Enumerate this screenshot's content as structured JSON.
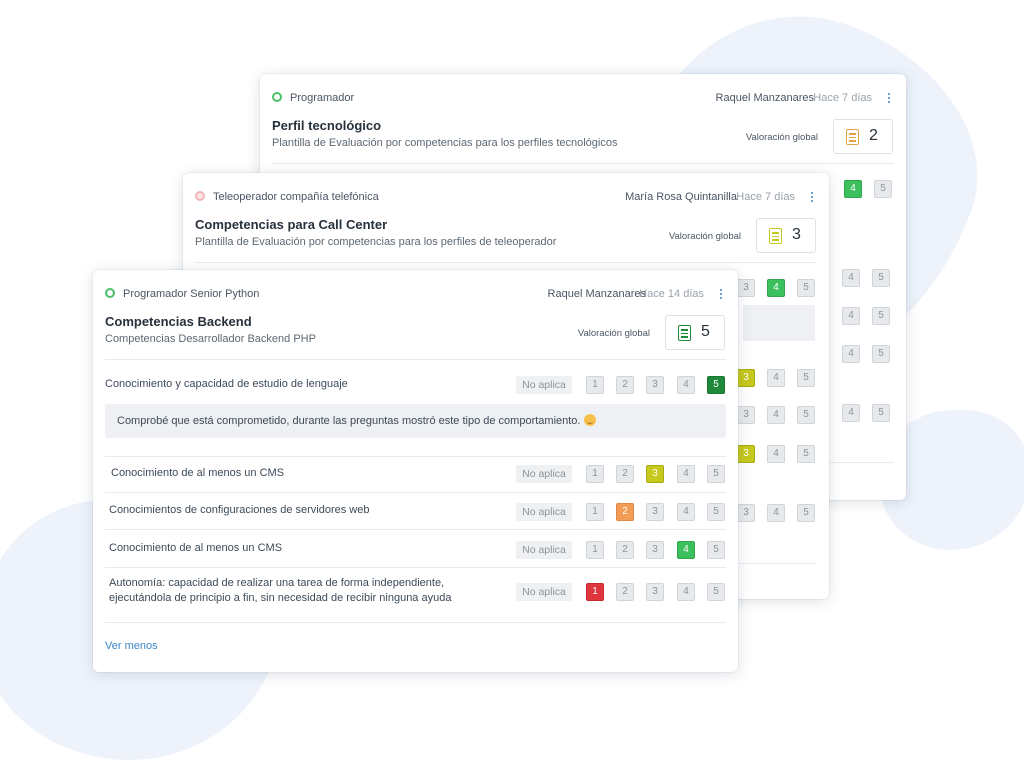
{
  "background_colors": {
    "blob": "#eef3fb",
    "page": "#ffffff"
  },
  "cards": {
    "back": {
      "role": "Programador",
      "status_color": "#4cc16a",
      "author": "Raquel Manzanares",
      "date": "Hace 7 días",
      "title": "Perfil tecnológico",
      "subtitle": "Plantilla de Evaluación por competencias para los perfiles tecnológicos",
      "valoracion_label": "Valoración global",
      "valoracion_value": "2",
      "valoracion_icon": "clipboard-list-icon",
      "valoracion_color": "#e2a24a",
      "peek_scale": [
        "4",
        "5"
      ]
    },
    "mid": {
      "role": "Teleoperador compañía telefónica",
      "status_color": "#f1b8b8",
      "author": "María Rosa Quintanilla",
      "date": "Hace 7 días",
      "title": "Competencias para Call Center",
      "subtitle": "Plantilla de Evaluación por competencias para los perfiles de teleoperador",
      "valoracion_label": "Valoración global",
      "valoracion_value": "3",
      "valoracion_icon": "clipboard-list-icon",
      "valoracion_color": "#c6c81c",
      "peek_scale": [
        "3",
        "4",
        "5"
      ]
    },
    "front": {
      "role": "Programador Senior Python",
      "status_color": "#4cc16a",
      "author": "Raquel Manzanares",
      "date": "Hace 14 días",
      "title": "Competencias Backend",
      "subtitle": "Competencias Desarrollador Backend PHP",
      "valoracion_label": "Valoración global",
      "valoracion_value": "5",
      "valoracion_icon": "clipboard-list-icon",
      "valoracion_color": "#208a3a",
      "na_label": "No aplica",
      "scale": [
        "1",
        "2",
        "3",
        "4",
        "5"
      ],
      "criteria": [
        {
          "label": "Conocimiento y capacidad de estudio de lenguaje",
          "selected": 5,
          "color": "#208a3a"
        },
        {
          "label": "Conocimiento de al menos un CMS",
          "selected": 3,
          "color": "#c6c81c"
        },
        {
          "label": "Conocimientos de configuraciones de servidores web",
          "selected": 2,
          "color": "#f39c55"
        },
        {
          "label": "Conocimiento de al menos un CMS",
          "selected": 4,
          "color": "#3cc05d"
        },
        {
          "label_line1": "Autonomía: capacidad de realizar una tarea de forma independiente,",
          "label_line2": "ejecutándola de principio a fin, sin necesidad de recibir ninguna ayuda",
          "selected": 1,
          "color": "#e0353d"
        }
      ],
      "comment": "Comprobé que está comprometido, durante las preguntas mostró este tipo de comportamiento.",
      "comment_emoji": "smiling-face-emoji",
      "toggle_link": "Ver menos"
    }
  }
}
